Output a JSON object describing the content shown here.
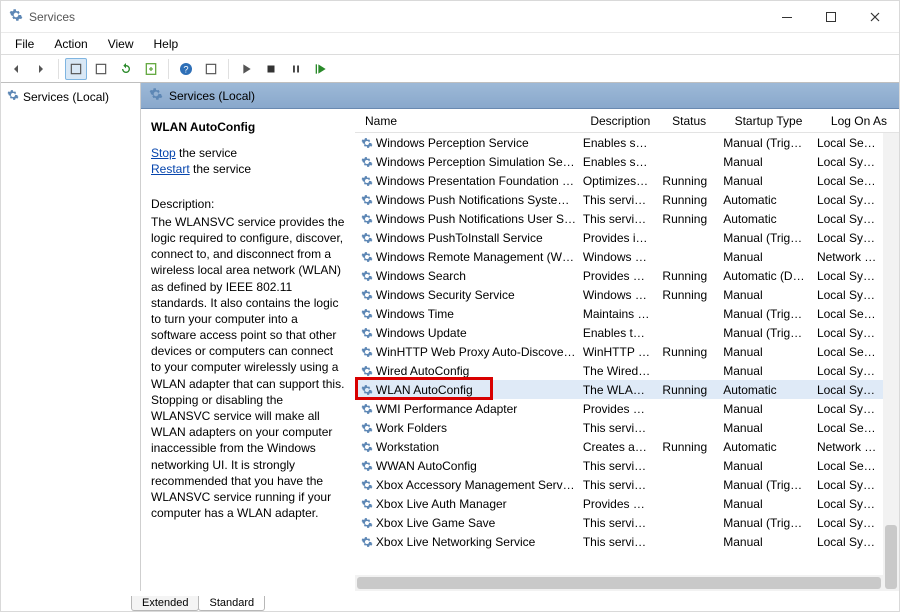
{
  "window": {
    "title": "Services"
  },
  "menubar": [
    "File",
    "Action",
    "View",
    "Help"
  ],
  "tree": {
    "root": "Services (Local)"
  },
  "panel_header": "Services (Local)",
  "detail": {
    "service_name": "WLAN AutoConfig",
    "stop_link": "Stop",
    "stop_rest": " the service",
    "restart_link": "Restart",
    "restart_rest": " the service",
    "desc_label": "Description:",
    "desc_text": "The WLANSVC service provides the logic required to configure, discover, connect to, and disconnect from a wireless local area network (WLAN) as defined by IEEE 802.11 standards. It also contains the logic to turn your computer into a software access point so that other devices or computers can connect to your computer wirelessly using a WLAN adapter that can support this. Stopping or disabling the WLANSVC service will make all WLAN adapters on your computer inaccessible from the Windows networking UI. It is strongly recommended that you have the WLANSVC service running if your computer has a WLAN adapter."
  },
  "columns": {
    "name": "Name",
    "desc": "Description",
    "status": "Status",
    "startup": "Startup Type",
    "logon": "Log On As"
  },
  "rows": [
    {
      "name": "Windows Perception Service",
      "desc": "Enables spat...",
      "status": "",
      "startup": "Manual (Trigg...",
      "logon": "Local Servic"
    },
    {
      "name": "Windows Perception Simulation Service",
      "desc": "Enables spat...",
      "status": "",
      "startup": "Manual",
      "logon": "Local Syster"
    },
    {
      "name": "Windows Presentation Foundation Fo...",
      "desc": "Optimizes p...",
      "status": "Running",
      "startup": "Manual",
      "logon": "Local Servic"
    },
    {
      "name": "Windows Push Notifications System Se...",
      "desc": "This service r...",
      "status": "Running",
      "startup": "Automatic",
      "logon": "Local Syster"
    },
    {
      "name": "Windows Push Notifications User Servi...",
      "desc": "This service r...",
      "status": "Running",
      "startup": "Automatic",
      "logon": "Local Syster"
    },
    {
      "name": "Windows PushToInstall Service",
      "desc": "Provides infr...",
      "status": "",
      "startup": "Manual (Trigg...",
      "logon": "Local Syster"
    },
    {
      "name": "Windows Remote Management (WS-...",
      "desc": "Windows Re...",
      "status": "",
      "startup": "Manual",
      "logon": "Network Se"
    },
    {
      "name": "Windows Search",
      "desc": "Provides co...",
      "status": "Running",
      "startup": "Automatic (De...",
      "logon": "Local Syster"
    },
    {
      "name": "Windows Security Service",
      "desc": "Windows Se...",
      "status": "Running",
      "startup": "Manual",
      "logon": "Local Syster"
    },
    {
      "name": "Windows Time",
      "desc": "Maintains d...",
      "status": "",
      "startup": "Manual (Trigg...",
      "logon": "Local Servic"
    },
    {
      "name": "Windows Update",
      "desc": "Enables the ...",
      "status": "",
      "startup": "Manual (Trigg...",
      "logon": "Local Syster"
    },
    {
      "name": "WinHTTP Web Proxy Auto-Discovery S...",
      "desc": "WinHTTP im...",
      "status": "Running",
      "startup": "Manual",
      "logon": "Local Servic"
    },
    {
      "name": "Wired AutoConfig",
      "desc": "The Wired A...",
      "status": "",
      "startup": "Manual",
      "logon": "Local Syster"
    },
    {
      "name": "WLAN AutoConfig",
      "desc": "The WLANS...",
      "status": "Running",
      "startup": "Automatic",
      "logon": "Local Syster",
      "selected": true
    },
    {
      "name": "WMI Performance Adapter",
      "desc": "Provides per...",
      "status": "",
      "startup": "Manual",
      "logon": "Local Syster"
    },
    {
      "name": "Work Folders",
      "desc": "This service ...",
      "status": "",
      "startup": "Manual",
      "logon": "Local Servic"
    },
    {
      "name": "Workstation",
      "desc": "Creates and ...",
      "status": "Running",
      "startup": "Automatic",
      "logon": "Network Se"
    },
    {
      "name": "WWAN AutoConfig",
      "desc": "This service ...",
      "status": "",
      "startup": "Manual",
      "logon": "Local Servic"
    },
    {
      "name": "Xbox Accessory Management Service",
      "desc": "This service ...",
      "status": "",
      "startup": "Manual (Trigg...",
      "logon": "Local Syster"
    },
    {
      "name": "Xbox Live Auth Manager",
      "desc": "Provides aut...",
      "status": "",
      "startup": "Manual",
      "logon": "Local Syster"
    },
    {
      "name": "Xbox Live Game Save",
      "desc": "This service ...",
      "status": "",
      "startup": "Manual (Trigg...",
      "logon": "Local Syster"
    },
    {
      "name": "Xbox Live Networking Service",
      "desc": "This service ...",
      "status": "",
      "startup": "Manual",
      "logon": "Local Syster"
    }
  ],
  "tabs": {
    "extended": "Extended",
    "standard": "Standard"
  }
}
